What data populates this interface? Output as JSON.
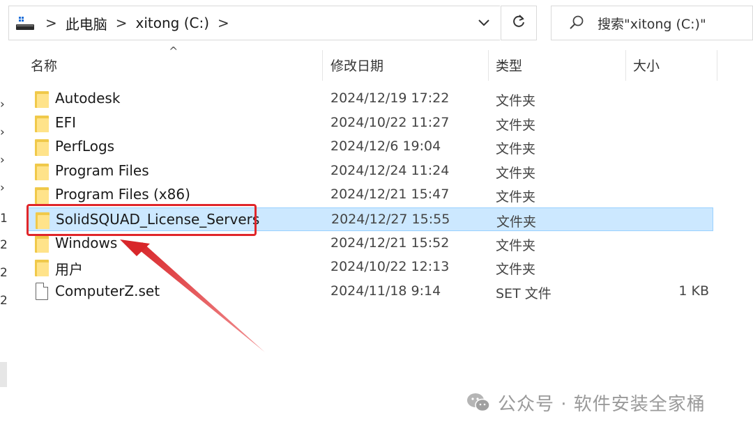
{
  "address_bar": {
    "breadcrumbs": [
      "此电脑",
      "xitong (C:)"
    ],
    "separator": ">"
  },
  "search": {
    "placeholder": "搜索\"xitong (C:)\""
  },
  "columns": {
    "name": "名称",
    "date": "修改日期",
    "type": "类型",
    "size": "大小"
  },
  "left_strip_marks": [
    "1",
    "2",
    "2",
    "2"
  ],
  "files": [
    {
      "name": "Autodesk",
      "date": "2024/12/19 17:22",
      "type": "文件夹",
      "size": "",
      "kind": "folder"
    },
    {
      "name": "EFI",
      "date": "2024/10/22 11:27",
      "type": "文件夹",
      "size": "",
      "kind": "folder"
    },
    {
      "name": "PerfLogs",
      "date": "2024/12/6 19:04",
      "type": "文件夹",
      "size": "",
      "kind": "folder"
    },
    {
      "name": "Program Files",
      "date": "2024/12/24 11:24",
      "type": "文件夹",
      "size": "",
      "kind": "folder"
    },
    {
      "name": "Program Files (x86)",
      "date": "2024/12/21 15:47",
      "type": "文件夹",
      "size": "",
      "kind": "folder"
    },
    {
      "name": "SolidSQUAD_License_Servers",
      "date": "2024/12/27 15:55",
      "type": "文件夹",
      "size": "",
      "kind": "folder",
      "selected": true
    },
    {
      "name": "Windows",
      "date": "2024/12/21 15:52",
      "type": "文件夹",
      "size": "",
      "kind": "folder"
    },
    {
      "name": "用户",
      "date": "2024/10/22 12:13",
      "type": "文件夹",
      "size": "",
      "kind": "folder"
    },
    {
      "name": "ComputerZ.set",
      "date": "2024/11/18 9:14",
      "type": "SET 文件",
      "size": "1 KB",
      "kind": "file"
    }
  ],
  "watermark": {
    "text": "公众号 · 软件安装全家桶"
  },
  "colors": {
    "selection_bg": "#cce8ff",
    "highlight_red": "#e0262a",
    "folder_yellow": "#f0c94a"
  },
  "icons": {
    "address": "this-pc-icon",
    "dropdown": "chevron-down-icon",
    "refresh": "refresh-icon",
    "search": "search-icon",
    "sort": "sort-up-icon",
    "watermark": "wechat-icon"
  }
}
